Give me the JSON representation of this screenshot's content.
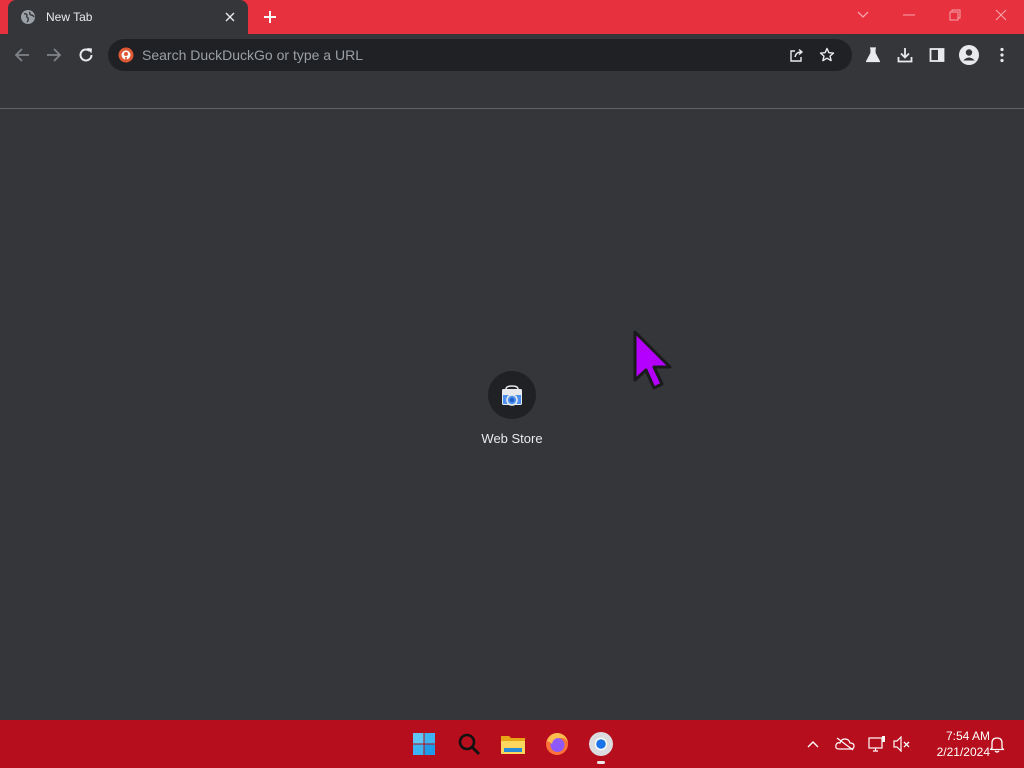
{
  "tab": {
    "title": "New Tab",
    "favicon": "globe-icon"
  },
  "window_controls": [
    "chevron-down-icon",
    "minimize-icon",
    "restore-icon",
    "close-icon"
  ],
  "toolbar": {
    "omnibox_placeholder": "Search DuckDuckGo or type a URL",
    "search_engine_icon": "duckduckgo-icon"
  },
  "shortcuts": [
    {
      "title": "Web Store",
      "icon": "web-store-icon"
    }
  ],
  "taskbar": {
    "apps": [
      "start-icon",
      "search-icon",
      "file-explorer-icon",
      "firefox-icon",
      "chrome-icon"
    ],
    "tray": [
      "chevron-up-icon",
      "onedrive-icon",
      "network-icon",
      "volume-muted-icon"
    ],
    "time": "7:54 AM",
    "date": "2/21/2024"
  },
  "colors": {
    "titlebar": "#e8313f",
    "toolbar": "#35363a",
    "omnibox": "#202124",
    "taskbar": "#b60e1c",
    "cursor": "#b400ff"
  }
}
